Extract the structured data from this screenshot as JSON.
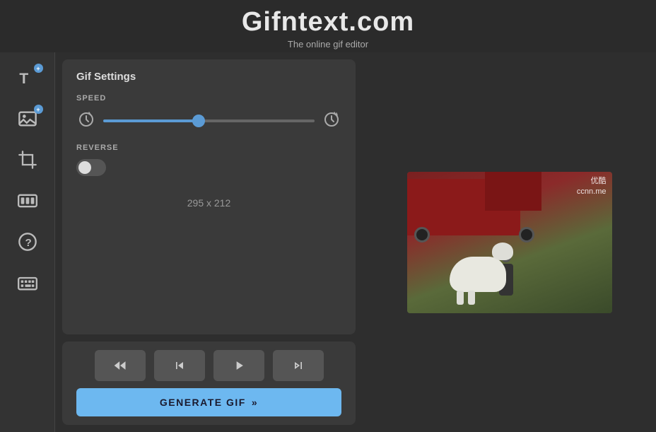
{
  "header": {
    "title": "Gifntext.com",
    "subtitle": "The online gif editor"
  },
  "sidebar": {
    "items": [
      {
        "id": "add-text",
        "icon": "T+",
        "label": "Add Text"
      },
      {
        "id": "add-image",
        "icon": "IMG+",
        "label": "Add Image"
      },
      {
        "id": "crop",
        "icon": "CROP",
        "label": "Crop"
      },
      {
        "id": "trim",
        "icon": "TRIM",
        "label": "Trim Frames"
      },
      {
        "id": "help",
        "icon": "?",
        "label": "Help"
      },
      {
        "id": "keyboard",
        "icon": "KB",
        "label": "Keyboard Shortcuts"
      }
    ]
  },
  "settings": {
    "title": "Gif Settings",
    "speed_label": "SPEED",
    "speed_value": 45,
    "reverse_label": "REVERSE",
    "reverse_on": false,
    "dimensions": "295 x 212"
  },
  "playback": {
    "rewind_label": "⏪",
    "prev_label": "⏮",
    "play_label": "▶",
    "next_label": "⏭"
  },
  "generate": {
    "label": "GENERATE GIF",
    "icon": "»"
  },
  "preview": {
    "watermark_line1": "优酷",
    "watermark_line2": "ccnn.me"
  }
}
